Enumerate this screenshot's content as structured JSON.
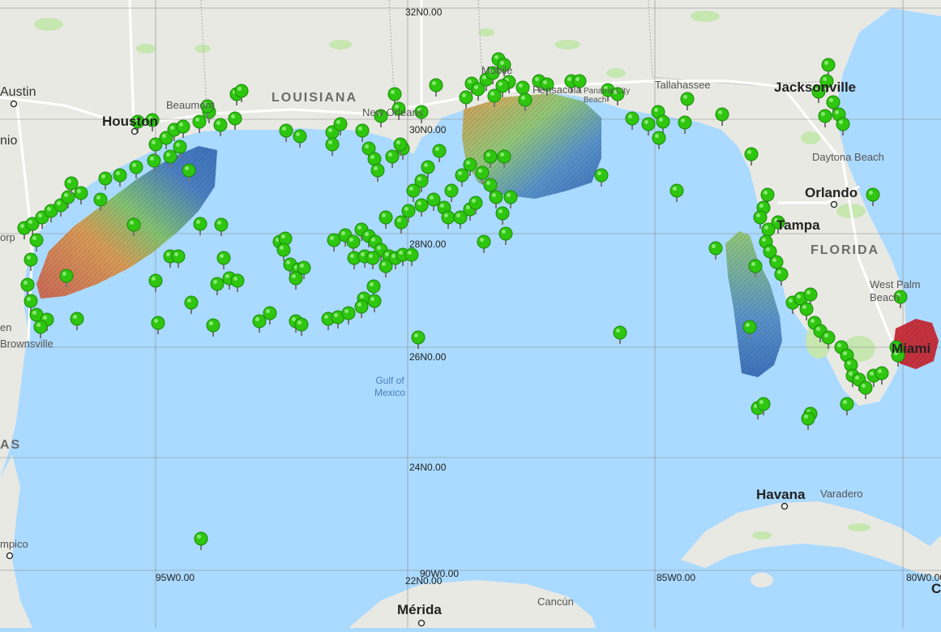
{
  "map": {
    "grid_labels": {
      "lat_32": "32N0.00",
      "lat_30": "30N0.00",
      "lat_28": "28N0.00",
      "lat_26": "26N0.00",
      "lat_24": "24N0.00",
      "lat_22": "22N0.00",
      "lon_95": "95W0.00",
      "lon_90": "90W0.00",
      "lon_85": "85W0.00",
      "lon_80": "80W0.00"
    },
    "states": {
      "louisiana": "LOUISIANA",
      "florida": "FLORIDA",
      "texas_partial": "AS"
    },
    "water": {
      "gulf_line1": "Gulf of",
      "gulf_line2": "Mexico"
    },
    "cities": {
      "austin": "Austin",
      "houston": "Houston",
      "antonio": "nio",
      "beaumont": "Beaumont",
      "new_orleans": "New Orleans",
      "mobile": "Mobile",
      "pensacola": "Pensacola",
      "panama_city": "Panama City Beach",
      "tallahassee": "Tallahassee",
      "jacksonville": "Jacksonville",
      "daytona": "Daytona Beach",
      "orlando": "Orlando",
      "tampa": "Tampa",
      "west_palm": "West Palm Beach",
      "miami": "Miami",
      "corpus": "orp",
      "brownsville_en": "en",
      "brownsville": "Brownsville",
      "tampico": "mpico",
      "havana": "Havana",
      "varadero": "Varadero",
      "merida": "Mérida",
      "cancun": "Cancún",
      "edge_c": "C"
    },
    "colors": {
      "water": "#aadaff",
      "land": "#e9e9e4",
      "park": "#c6e7b0",
      "marker": "#2ec60f",
      "heat_red": "#c8202a",
      "heat_orange": "#e07a30",
      "heat_green": "#6fbf50",
      "heat_blue": "#2a5fb0"
    },
    "marker_icon": "green-map-pin-icon"
  }
}
